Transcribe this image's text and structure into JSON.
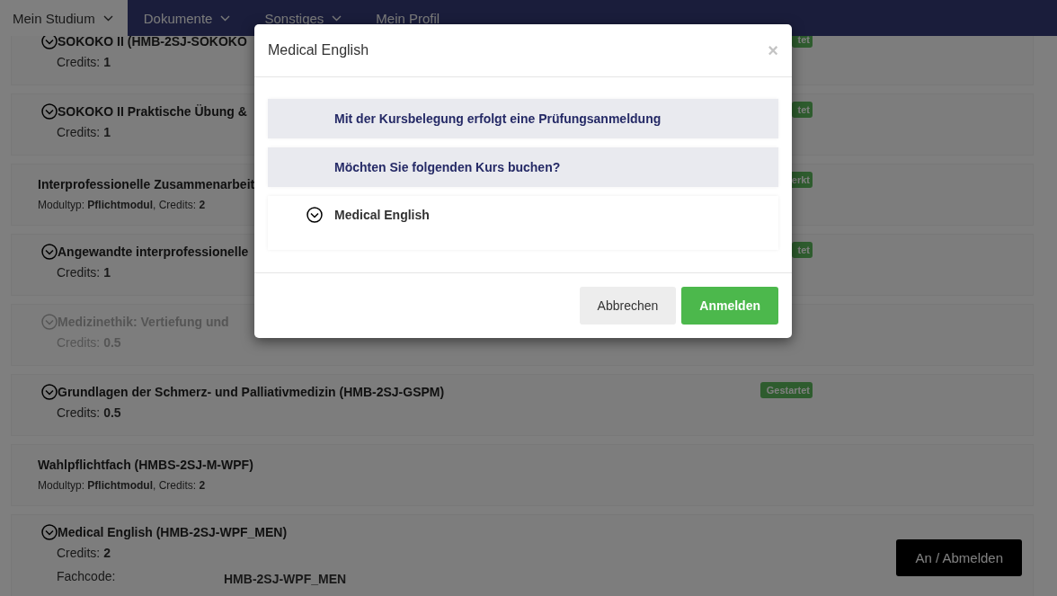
{
  "nav": [
    {
      "label": "Mein Studium",
      "dropdown": true,
      "selected": true
    },
    {
      "label": "Dokumente",
      "dropdown": true,
      "selected": false
    },
    {
      "label": "Sonstiges",
      "dropdown": true,
      "selected": false
    },
    {
      "label": "Mein Profil",
      "dropdown": false,
      "selected": false
    }
  ],
  "rows": [
    {
      "kind": "course",
      "title": "SOKOKO II (HMB-2SJ-SOKOKO",
      "meta": "Credits: **1**",
      "badge": "tet",
      "disabled": false
    },
    {
      "kind": "course",
      "title": "SOKOKO II Praktische Übung &",
      "meta": "Credits: **1**",
      "badge": "tet",
      "disabled": false
    },
    {
      "kind": "module",
      "title": "Interprofessionelle Zusammenarbeit",
      "meta": "Modultyp: **Pflichtmodul**, Credits: **2**",
      "badge": "erkt",
      "disabled": false
    },
    {
      "kind": "course",
      "title": "Angewandte interprofessionelle",
      "meta": "Credits: **1**",
      "badge": "tet",
      "disabled": false
    },
    {
      "kind": "course",
      "title": "Medizinethik: Vertiefung und",
      "meta": "Credits: **0.5**",
      "disabled": true
    },
    {
      "kind": "course",
      "title": "Grundlagen der Schmerz- und Palliativmedizin (HMB-2SJ-GSPM)",
      "meta": "Credits: **0.5**",
      "badge": "Gestartet",
      "disabled": false
    },
    {
      "kind": "module",
      "title": "Wahlpflichtfach (HMBS-2SJ-M-WPF)",
      "meta": "Modultyp: **Pflichtmodul**, Credits: **2**",
      "disabled": false
    },
    {
      "kind": "course",
      "title": "Medical English (HMB-2SJ-WPF_MEN)",
      "meta": "Credits: **2**",
      "code_label": "Fachcode:",
      "code_value": "HMB-2SJ-WPF_MEN",
      "action": "An / Abmelden",
      "disabled": false
    }
  ],
  "modal": {
    "title": "Medical English",
    "close": "×",
    "notices": [
      "Mit der Kursbelegung erfolgt eine Prüfungsanmeldung",
      "Möchten Sie folgenden Kurs buchen?"
    ],
    "course": "Medical English",
    "buttons": [
      {
        "label": "Abbrechen",
        "kind": "secondary"
      },
      {
        "label": "Anmelden",
        "kind": "primary"
      }
    ]
  }
}
